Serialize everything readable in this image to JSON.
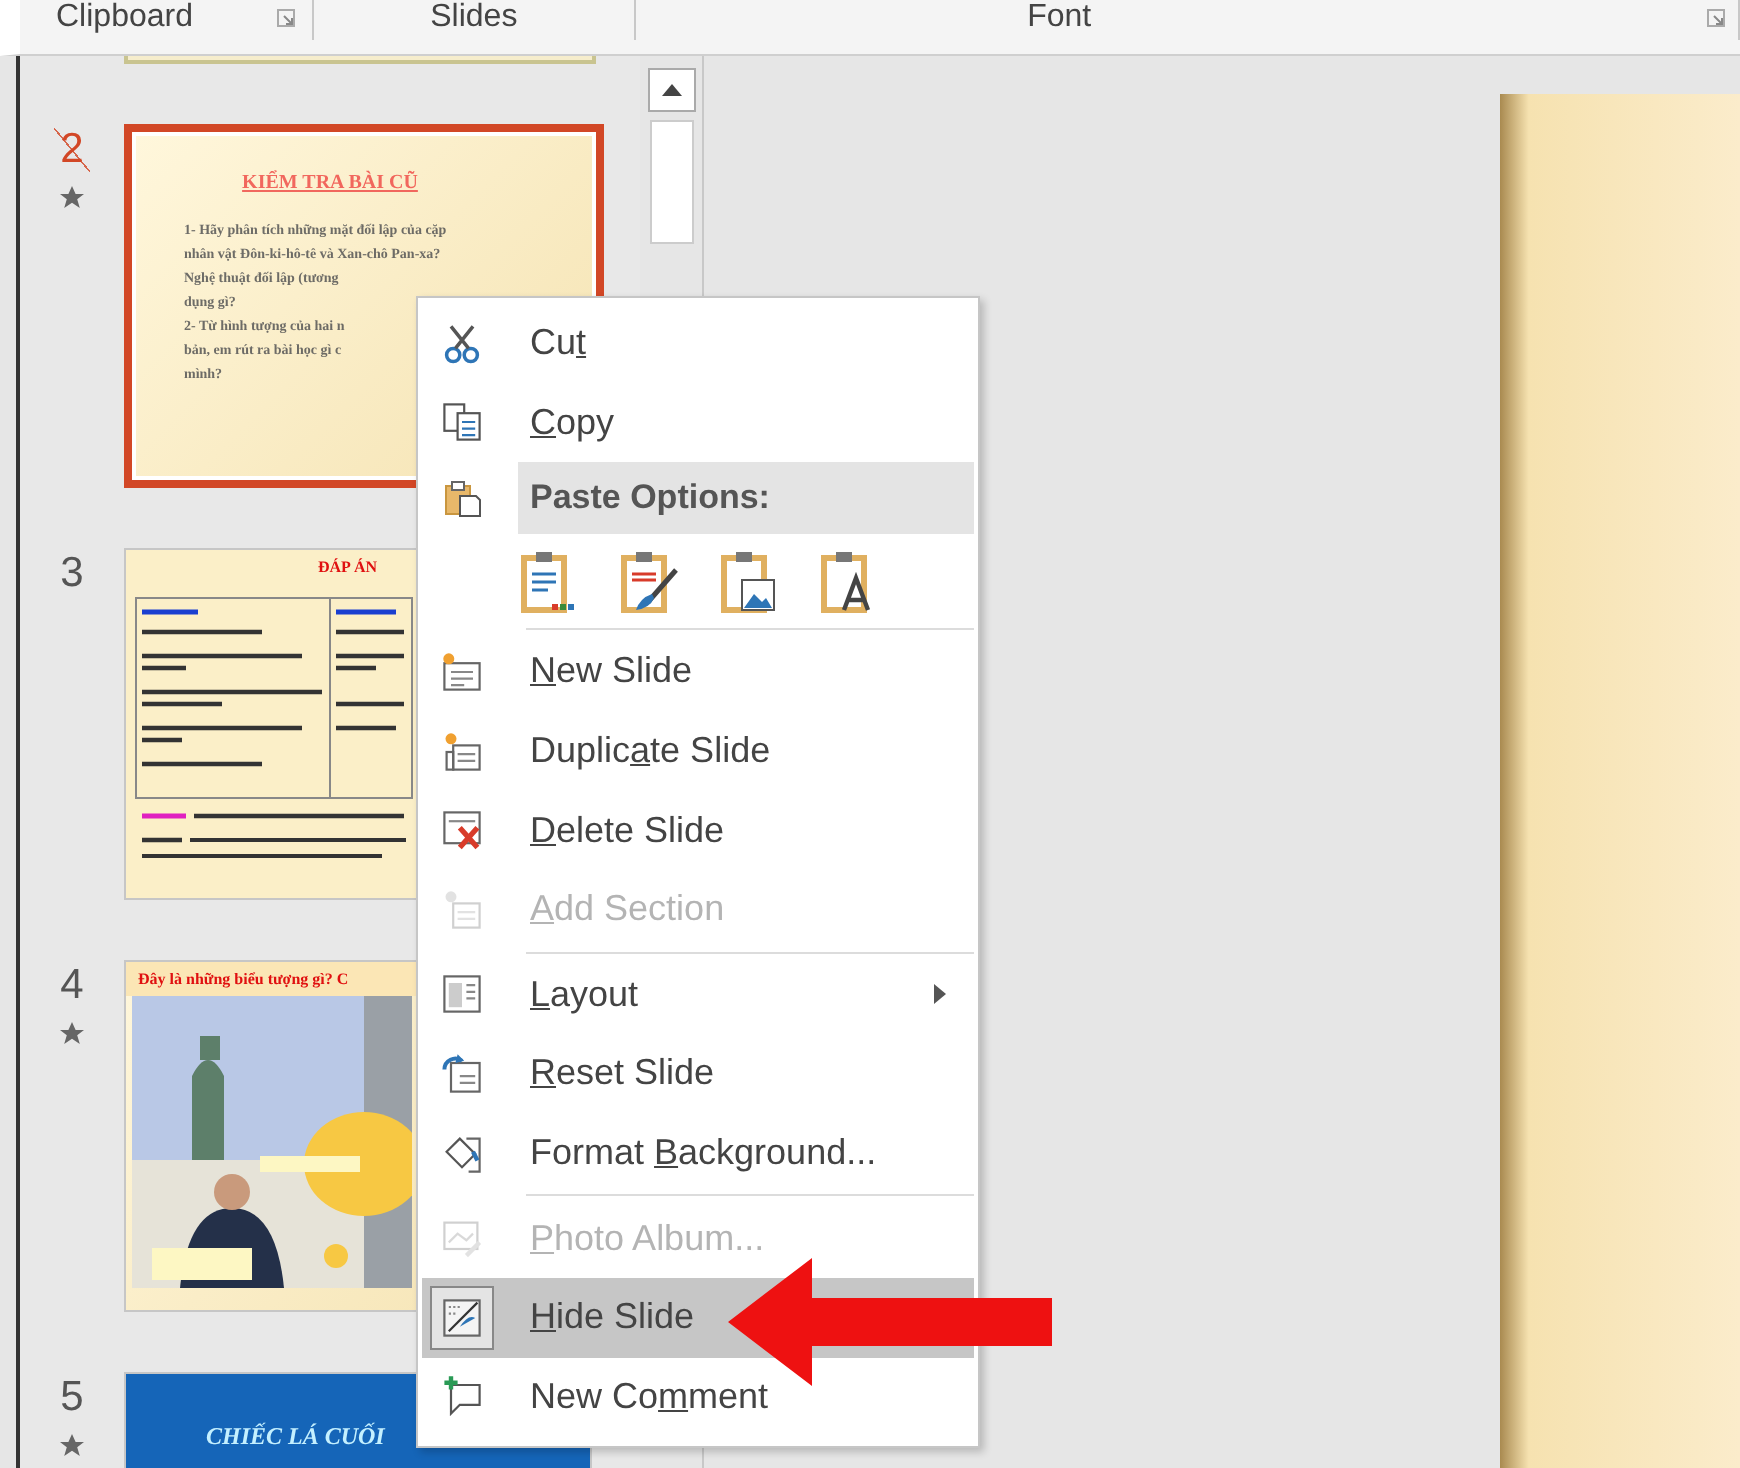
{
  "ribbon_groups": [
    {
      "label": "Clipboard",
      "launcher": true
    },
    {
      "label": "Slides",
      "launcher": false
    },
    {
      "label": "Font",
      "launcher": true
    }
  ],
  "slides": [
    {
      "kind": "partial",
      "selected": false
    },
    {
      "number": "2",
      "kind": "text",
      "selected": true,
      "hidden": true,
      "animated": true,
      "title": "KIỂM TRA BÀI CŨ",
      "lines": [
        "1- Hãy phân tích những mặt đối lập của cặp",
        "nhân vật Đôn-ki-hô-tê và Xan-chô Pan-xa?",
        "Nghệ thuật đối lập (tương",
        "dụng gì?",
        "2- Từ hình tượng của hai n",
        "bản, em rút ra bài học gì c",
        "mình?"
      ]
    },
    {
      "number": "3",
      "kind": "table",
      "selected": false,
      "hidden": false,
      "animated": false,
      "title": "ĐÁP ÁN"
    },
    {
      "number": "4",
      "kind": "photos",
      "selected": false,
      "hidden": false,
      "animated": true,
      "title": "Đây là những biểu tượng gì? C"
    },
    {
      "number": "5",
      "kind": "banner",
      "selected": false,
      "hidden": false,
      "animated": true,
      "title": "CHIẾC LÁ CUỐI"
    }
  ],
  "context_menu": [
    {
      "kind": "item",
      "before": "Cu",
      "key": "t",
      "disabled": false,
      "selected": false,
      "submenu": false
    },
    {
      "kind": "item",
      "key": "C",
      "after": "opy",
      "disabled": false,
      "selected": false,
      "submenu": false
    },
    {
      "kind": "header",
      "label": "Paste Options:"
    },
    {
      "kind": "paste_icons"
    },
    {
      "kind": "separator"
    },
    {
      "kind": "item",
      "key": "N",
      "after": "ew Slide",
      "disabled": false,
      "selected": false,
      "submenu": false
    },
    {
      "kind": "item",
      "before": "Duplic",
      "key": "a",
      "after": "te Slide",
      "disabled": false,
      "selected": false,
      "submenu": false
    },
    {
      "kind": "item",
      "key": "D",
      "after": "elete Slide",
      "disabled": false,
      "selected": false,
      "submenu": false
    },
    {
      "kind": "item",
      "key": "A",
      "after": "dd Section",
      "disabled": true,
      "selected": false,
      "submenu": false
    },
    {
      "kind": "separator"
    },
    {
      "kind": "item",
      "key": "L",
      "after": "ayout",
      "disabled": false,
      "selected": false,
      "submenu": true
    },
    {
      "kind": "item",
      "key": "R",
      "after": "eset Slide",
      "disabled": false,
      "selected": false,
      "submenu": false
    },
    {
      "kind": "item",
      "before": "Format ",
      "key": "B",
      "after": "ackground...",
      "disabled": false,
      "selected": false,
      "submenu": false
    },
    {
      "kind": "separator"
    },
    {
      "kind": "item",
      "key": "P",
      "after": "hoto Album...",
      "disabled": true,
      "selected": false,
      "submenu": false
    },
    {
      "kind": "item",
      "key": "H",
      "after": "ide Slide",
      "disabled": false,
      "selected": true,
      "submenu": false
    },
    {
      "kind": "item",
      "before": "New Co",
      "key": "m",
      "after": "ment",
      "disabled": false,
      "selected": false,
      "submenu": false
    }
  ],
  "callout_arrow": true
}
